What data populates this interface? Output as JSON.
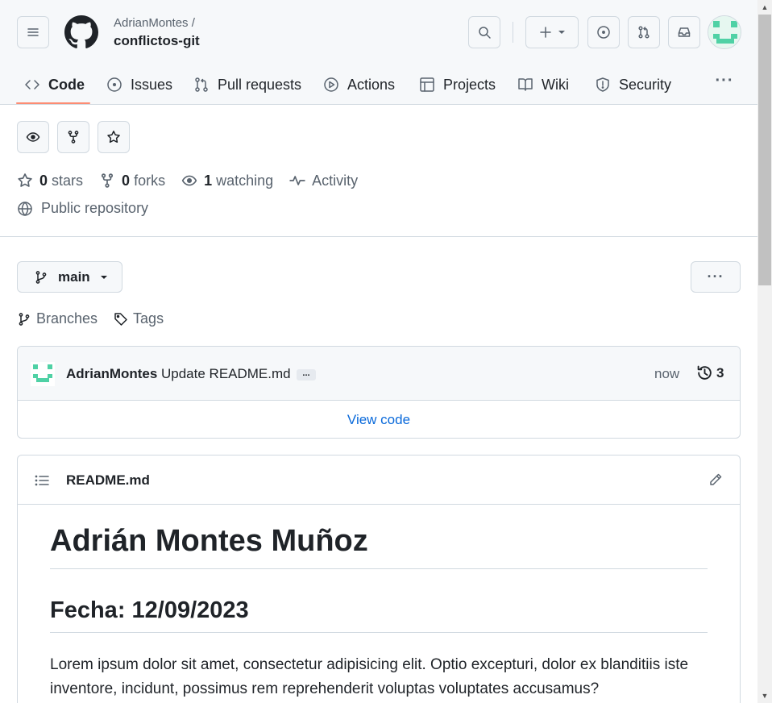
{
  "header": {
    "owner": "AdrianMontes /",
    "repo": "conflictos-git",
    "icons": [
      "hamburger-icon",
      "github-logo",
      "search-icon",
      "plus-icon",
      "issues-icon",
      "pull-request-icon",
      "inbox-icon"
    ]
  },
  "nav": {
    "tabs": [
      {
        "label": "Code",
        "icon": "code-icon"
      },
      {
        "label": "Issues",
        "icon": "issue-icon"
      },
      {
        "label": "Pull requests",
        "icon": "pull-request-icon"
      },
      {
        "label": "Actions",
        "icon": "play-icon"
      },
      {
        "label": "Projects",
        "icon": "table-icon"
      },
      {
        "label": "Wiki",
        "icon": "book-icon"
      },
      {
        "label": "Security",
        "icon": "shield-icon"
      }
    ],
    "more": "···"
  },
  "repo_meta": {
    "stars_count": "0",
    "stars_label": "stars",
    "forks_count": "0",
    "forks_label": "forks",
    "watching_count": "1",
    "watching_label": "watching",
    "activity_label": "Activity",
    "visibility": "Public repository"
  },
  "branch": {
    "name": "main",
    "branches_label": "Branches",
    "tags_label": "Tags",
    "more": "···"
  },
  "commit": {
    "author": "AdrianMontes",
    "message": "Update README.md",
    "ellipsis": "...",
    "time": "now",
    "history_count": "3",
    "view_code": "View code"
  },
  "readme": {
    "filename": "README.md",
    "h1": "Adrián Montes Muñoz",
    "h2": "Fecha: 12/09/2023",
    "paragraph": "Lorem ipsum dolor sit amet, consectetur adipisicing elit. Optio excepturi, dolor ex blanditiis iste inventore, incidunt, possimus rem reprehenderit voluptas voluptates accusamus?"
  },
  "colors": {
    "accent_underline": "#fd8c73",
    "link": "#0969da",
    "avatar": "#4fd1a5"
  }
}
